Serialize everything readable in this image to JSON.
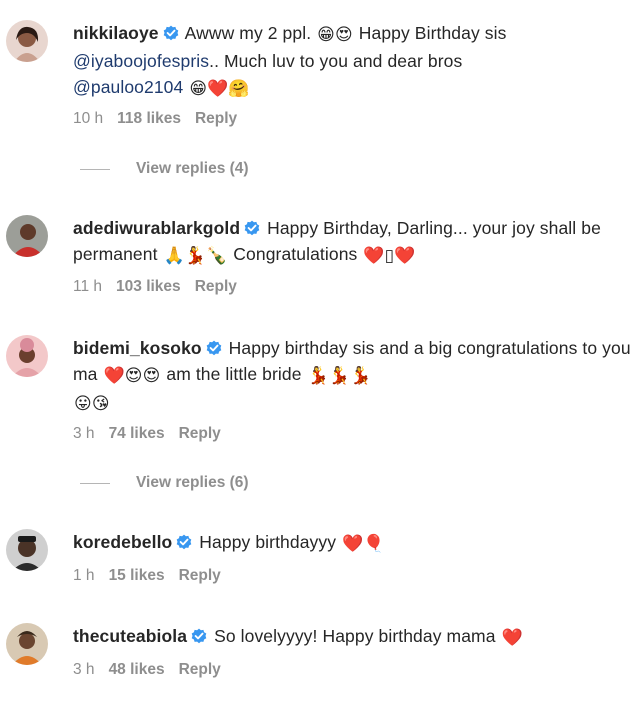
{
  "comments": [
    {
      "username": "nikkilaoye",
      "text1": " Awww my 2 ppl. ",
      "emojis1": "😁😍",
      "text2": " Happy Birthday sis",
      "mention1": "@iyaboojofespris",
      "text3": ".. Much luv to you and dear bros",
      "mention2": "@pauloo2104",
      "emojis2": "😁❤️🤗",
      "time": "10 h",
      "likes": "118 likes",
      "reply": "Reply",
      "view_replies": "View replies (4)"
    },
    {
      "username": "adediwurablarkgold",
      "text1": " Happy Birthday, Darling... your joy shall be permanent ",
      "emojis1": "🙏💃🍾",
      "text2": " Congratulations ",
      "emojis2": "❤️▯❤️",
      "time": "11 h",
      "likes": "103 likes",
      "reply": "Reply"
    },
    {
      "username": "bidemi_kosoko",
      "text1": " Happy birthday sis and a big congratulations to you ma ",
      "emojis1": "❤️😍😍",
      "text2": " am the little bride ",
      "emojis2": "💃💃💃",
      "emojis3": "😛😘",
      "time": "3 h",
      "likes": "74 likes",
      "reply": "Reply",
      "view_replies": "View replies (6)"
    },
    {
      "username": "koredebello",
      "text1": " Happy birthdayyy ",
      "emojis1": "❤️🎈",
      "time": "1 h",
      "likes": "15 likes",
      "reply": "Reply"
    },
    {
      "username": "thecuteabiola",
      "text1": " So lovelyyyy! Happy birthday mama ",
      "emojis1": "❤️",
      "time": "3 h",
      "likes": "48 likes",
      "reply": "Reply"
    }
  ],
  "colors": {
    "text": "#262626",
    "muted": "#8e8e8e",
    "verified": "#3897f0",
    "heart": "#e0245e"
  }
}
